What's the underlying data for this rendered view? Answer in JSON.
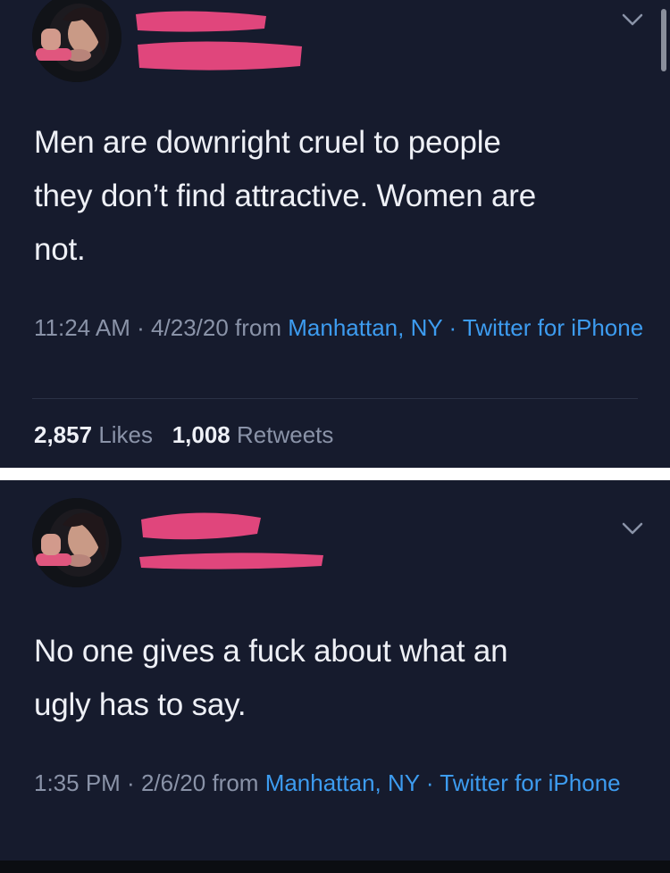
{
  "tweet1": {
    "text": "Men are downright cruel to people\nthey don’t find attractive. Women are\nnot.",
    "time": "11:24 AM",
    "sep1": " · ",
    "date": "4/23/20",
    "from": " from ",
    "location": "Manhattan, NY",
    "sep2": " · ",
    "client": "Twitter for iPhone",
    "likes_count": "2,857",
    "likes_label": "Likes",
    "retweets_count": "1,008",
    "retweets_label": "Retweets"
  },
  "tweet2": {
    "text": "No one gives a fuck about what an\nugly has to say.",
    "time": "1:35 PM",
    "sep1": " · ",
    "date": "2/6/20",
    "from": " from ",
    "location": "Manhattan, NY",
    "sep2": " · ",
    "client": "Twitter for iPhone"
  },
  "icons": {
    "menu": "chevron-down-icon",
    "avatar": "profile-photo"
  },
  "colors": {
    "background": "#161b2d",
    "link": "#3d9cf0",
    "muted": "#8a93a8",
    "redaction": "#e0467c"
  }
}
